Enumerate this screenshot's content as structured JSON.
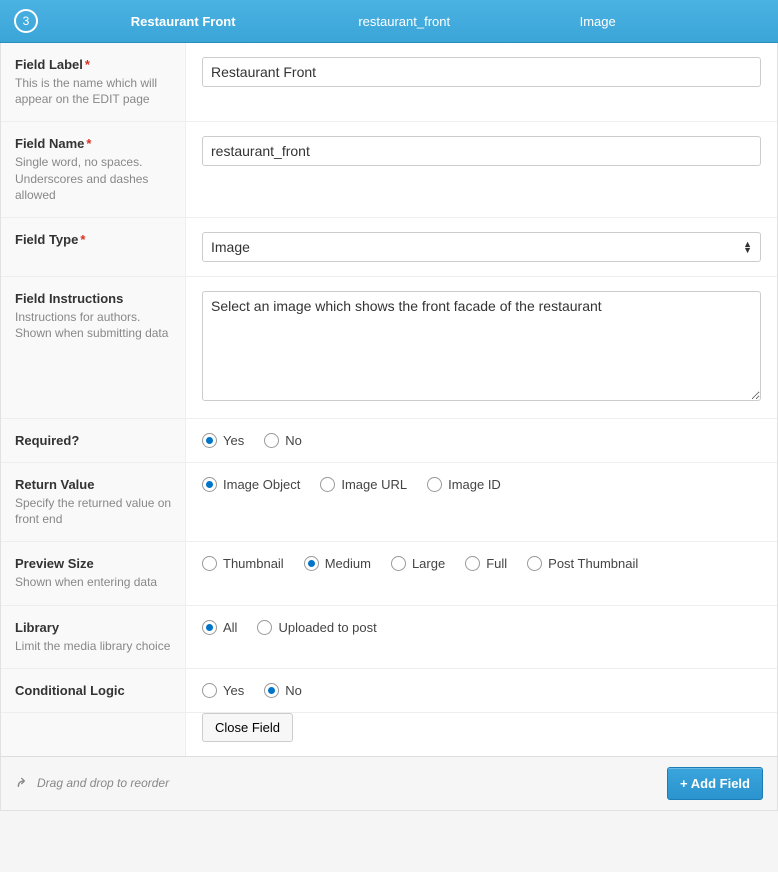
{
  "header": {
    "order": "3",
    "title": "Restaurant Front",
    "name": "restaurant_front",
    "type": "Image"
  },
  "rows": {
    "field_label": {
      "title": "Field Label",
      "required_symbol": "*",
      "desc": "This is the name which will appear on the EDIT page",
      "value": "Restaurant Front"
    },
    "field_name": {
      "title": "Field Name",
      "required_symbol": "*",
      "desc": "Single word, no spaces. Underscores and dashes allowed",
      "value": "restaurant_front"
    },
    "field_type": {
      "title": "Field Type",
      "required_symbol": "*",
      "value": "Image"
    },
    "instructions": {
      "title": "Field Instructions",
      "desc": "Instructions for authors. Shown when submitting data",
      "value": "Select an image which shows the front facade of the restaurant"
    },
    "required": {
      "title": "Required?",
      "options": {
        "yes": "Yes",
        "no": "No"
      }
    },
    "return_value": {
      "title": "Return Value",
      "desc": "Specify the returned value on front end",
      "options": {
        "object": "Image Object",
        "url": "Image URL",
        "id": "Image ID"
      }
    },
    "preview_size": {
      "title": "Preview Size",
      "desc": "Shown when entering data",
      "options": {
        "thumbnail": "Thumbnail",
        "medium": "Medium",
        "large": "Large",
        "full": "Full",
        "post_thumbnail": "Post Thumbnail"
      }
    },
    "library": {
      "title": "Library",
      "desc": "Limit the media library choice",
      "options": {
        "all": "All",
        "uploaded": "Uploaded to post"
      }
    },
    "conditional": {
      "title": "Conditional Logic",
      "options": {
        "yes": "Yes",
        "no": "No"
      }
    },
    "close_button": "Close Field"
  },
  "footer": {
    "reorder_hint": "Drag and drop to reorder",
    "add_button": "+ Add Field"
  }
}
